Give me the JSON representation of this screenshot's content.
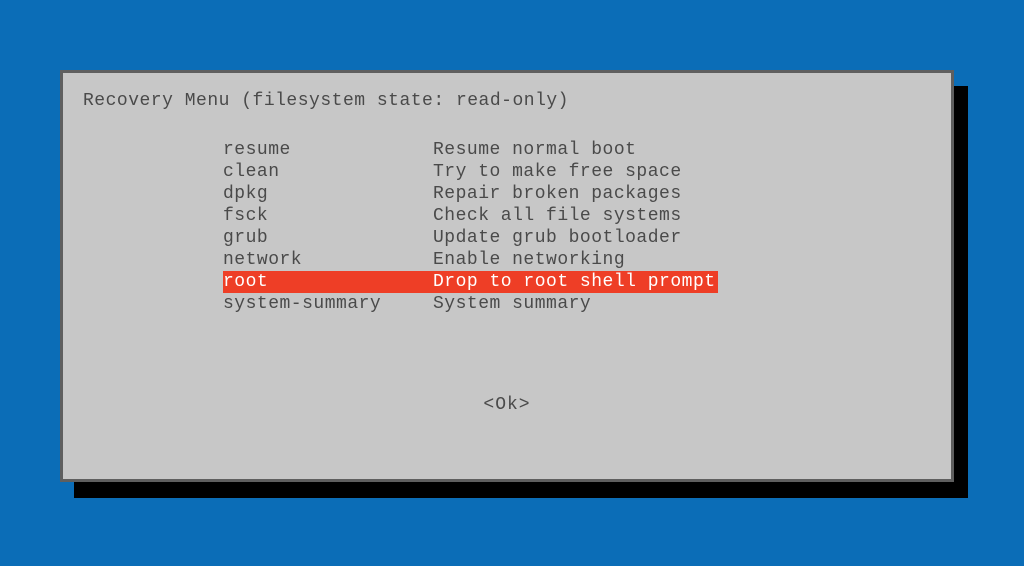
{
  "title": "Recovery Menu (filesystem state: read-only)",
  "menu": [
    {
      "key": "resume",
      "desc": "Resume normal boot",
      "selected": false
    },
    {
      "key": "clean",
      "desc": "Try to make free space",
      "selected": false
    },
    {
      "key": "dpkg",
      "desc": "Repair broken packages",
      "selected": false
    },
    {
      "key": "fsck",
      "desc": "Check all file systems",
      "selected": false
    },
    {
      "key": "grub",
      "desc": "Update grub bootloader",
      "selected": false
    },
    {
      "key": "network",
      "desc": "Enable networking",
      "selected": false
    },
    {
      "key": "root",
      "desc": "Drop to root shell prompt",
      "selected": true
    },
    {
      "key": "system-summary",
      "desc": "System summary",
      "selected": false
    }
  ],
  "ok_label": "<Ok>"
}
